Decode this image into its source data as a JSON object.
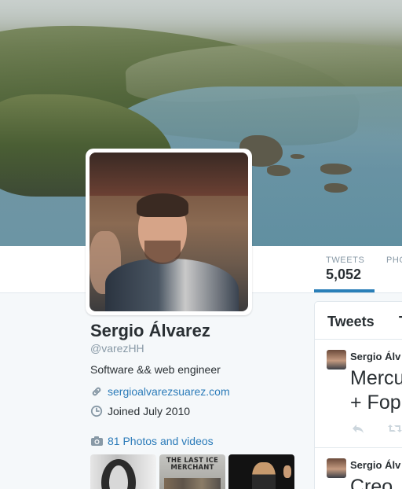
{
  "nav": {
    "stats": [
      {
        "label": "TWEETS",
        "value": "5,052"
      },
      {
        "label": "PHO",
        "value": ""
      }
    ]
  },
  "profile": {
    "name": "Sergio Álvarez",
    "handle": "@varezHH",
    "bio": "Software && web engineer",
    "url": "sergioalvarezsuarez.com",
    "joined": "Joined July 2010",
    "photos_link": "81 Photos and videos"
  },
  "thumbs": {
    "poster_title": "THE LAST ICE MERCHANT"
  },
  "timeline": {
    "tabs": [
      "Tweets",
      "T"
    ],
    "tweets": [
      {
        "author": "Sergio Álv",
        "text_lines": [
          "Mercu",
          "+ Fop"
        ]
      },
      {
        "author": "Sergio Álv",
        "text_lines": [
          "Creo"
        ]
      }
    ]
  },
  "colors": {
    "link": "#2b7bb9",
    "tab_underline": "#2a7fb8",
    "muted": "#8899a6"
  },
  "icons": [
    "link-icon",
    "calendar-icon",
    "camera-icon",
    "reply-icon",
    "retweet-icon"
  ]
}
